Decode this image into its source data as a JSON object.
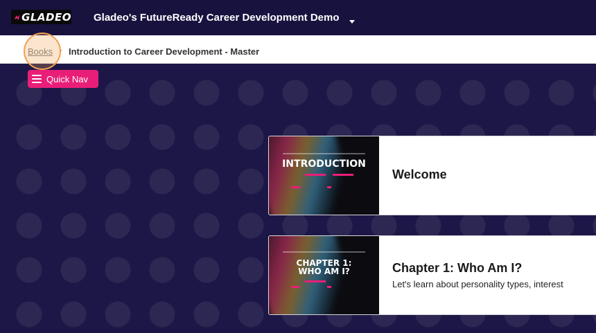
{
  "header": {
    "logo_text": "GLADEO",
    "course_title": "Gladeo's FutureReady Career Development Demo"
  },
  "breadcrumb": {
    "root": "Books",
    "current": "Introduction to Career Development - Master"
  },
  "quick_nav": {
    "label": "Quick Nav"
  },
  "cards": [
    {
      "thumb_title": "INTRODUCTION",
      "title": "Welcome",
      "description": ""
    },
    {
      "thumb_title_line1": "CHAPTER 1:",
      "thumb_title_line2": "WHO AM I?",
      "title": "Chapter 1: Who Am I?",
      "description": "Let's learn about personality types, interest"
    }
  ],
  "colors": {
    "header_bg": "#18123f",
    "content_bg": "#1d1747",
    "accent": "#e91e78",
    "highlight": "#f2a154"
  },
  "icons": {
    "logo": "gladeo-logo-icon",
    "menu": "hamburger-menu-icon",
    "dropdown": "chevron-down-icon",
    "separator": "chevron-right-icon"
  }
}
